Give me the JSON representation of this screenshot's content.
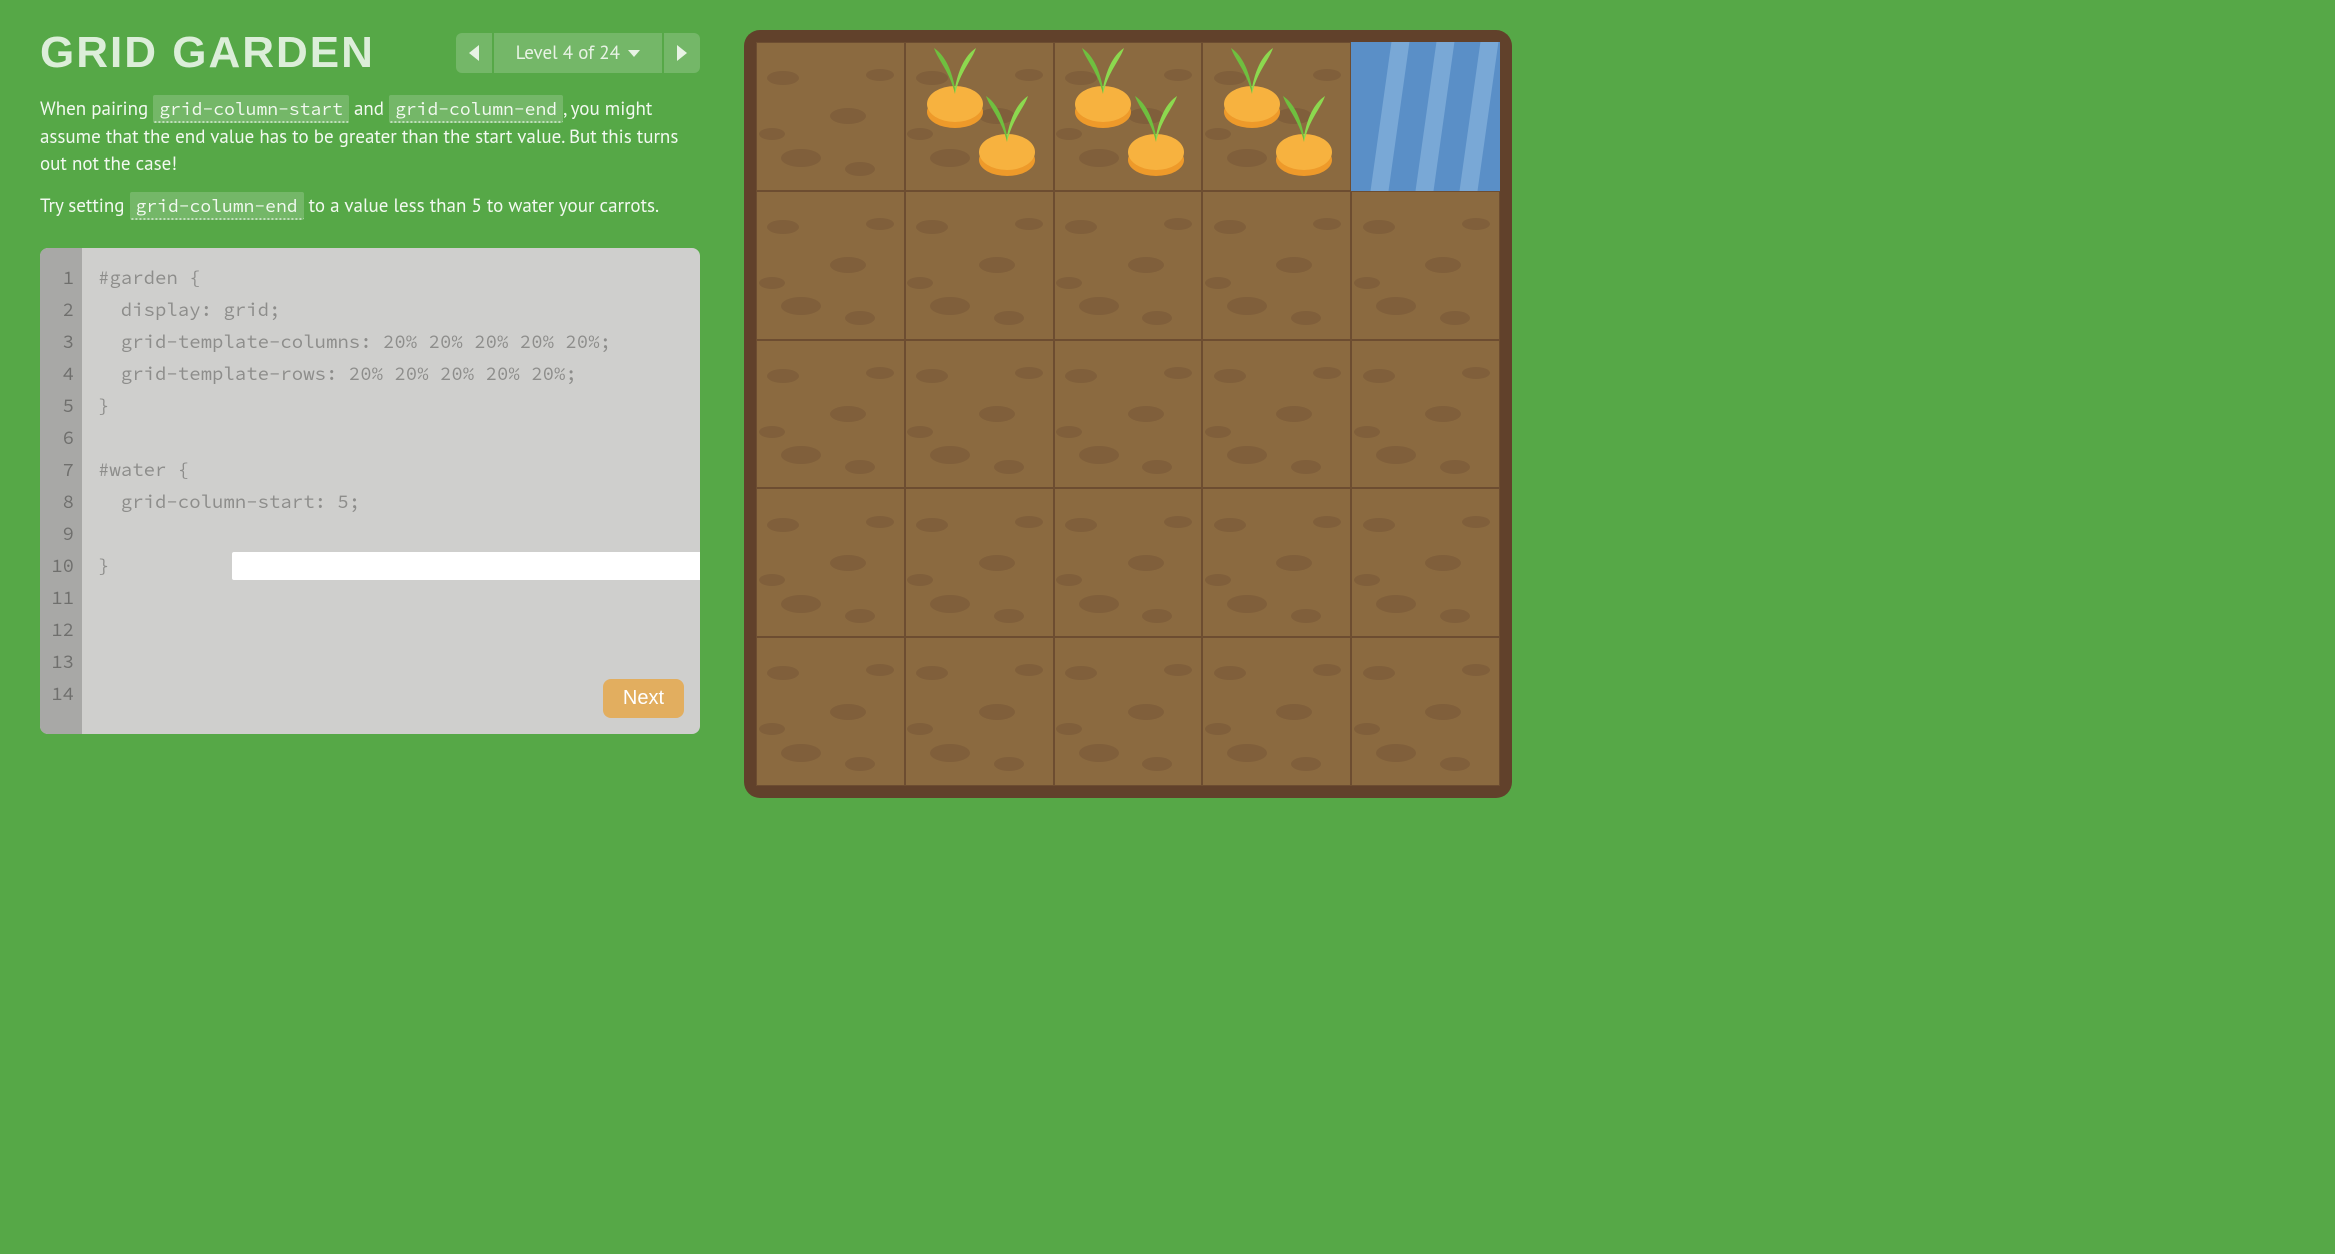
{
  "title": "GRID GARDEN",
  "level": {
    "label": "Level 4 of 24",
    "current": 4,
    "total": 24
  },
  "instructions": {
    "para1_pre": "When pairing ",
    "code1": "grid-column-start",
    "para1_mid": " and ",
    "code2": "grid-column-end",
    "para1_post": ", you might assume that the end value has to be greater than the start value. But this turns out not the case!",
    "para2_pre": "Try setting ",
    "code3": "grid-column-end",
    "para2_post": " to a value less than 5 to water your carrots."
  },
  "editor": {
    "line_numbers": [
      "1",
      "2",
      "3",
      "4",
      "5",
      "6",
      "7",
      "8",
      "9",
      "10",
      "11",
      "12",
      "13",
      "14"
    ],
    "lines": {
      "l1": "#garden {",
      "l2": "  display: grid;",
      "l3": "  grid-template-columns: 20% 20% 20% 20% 20%;",
      "l4": "  grid-template-rows: 20% 20% 20% 20% 20%;",
      "l5": "}",
      "l6": "",
      "l7": "#water {",
      "l8": "  grid-column-start: 5;",
      "l10": "}"
    },
    "input_value": "",
    "next_label": "Next"
  },
  "garden": {
    "grid_size": 5,
    "water": {
      "col": 5,
      "row": 1,
      "span_cols": 1,
      "span_rows": 1
    },
    "carrots": [
      {
        "col": 2,
        "row": 1,
        "offset": "tl"
      },
      {
        "col": 2,
        "row": 1,
        "offset": "br"
      },
      {
        "col": 3,
        "row": 1,
        "offset": "tl"
      },
      {
        "col": 3,
        "row": 1,
        "offset": "br"
      },
      {
        "col": 4,
        "row": 1,
        "offset": "tl"
      },
      {
        "col": 4,
        "row": 1,
        "offset": "br"
      }
    ]
  }
}
